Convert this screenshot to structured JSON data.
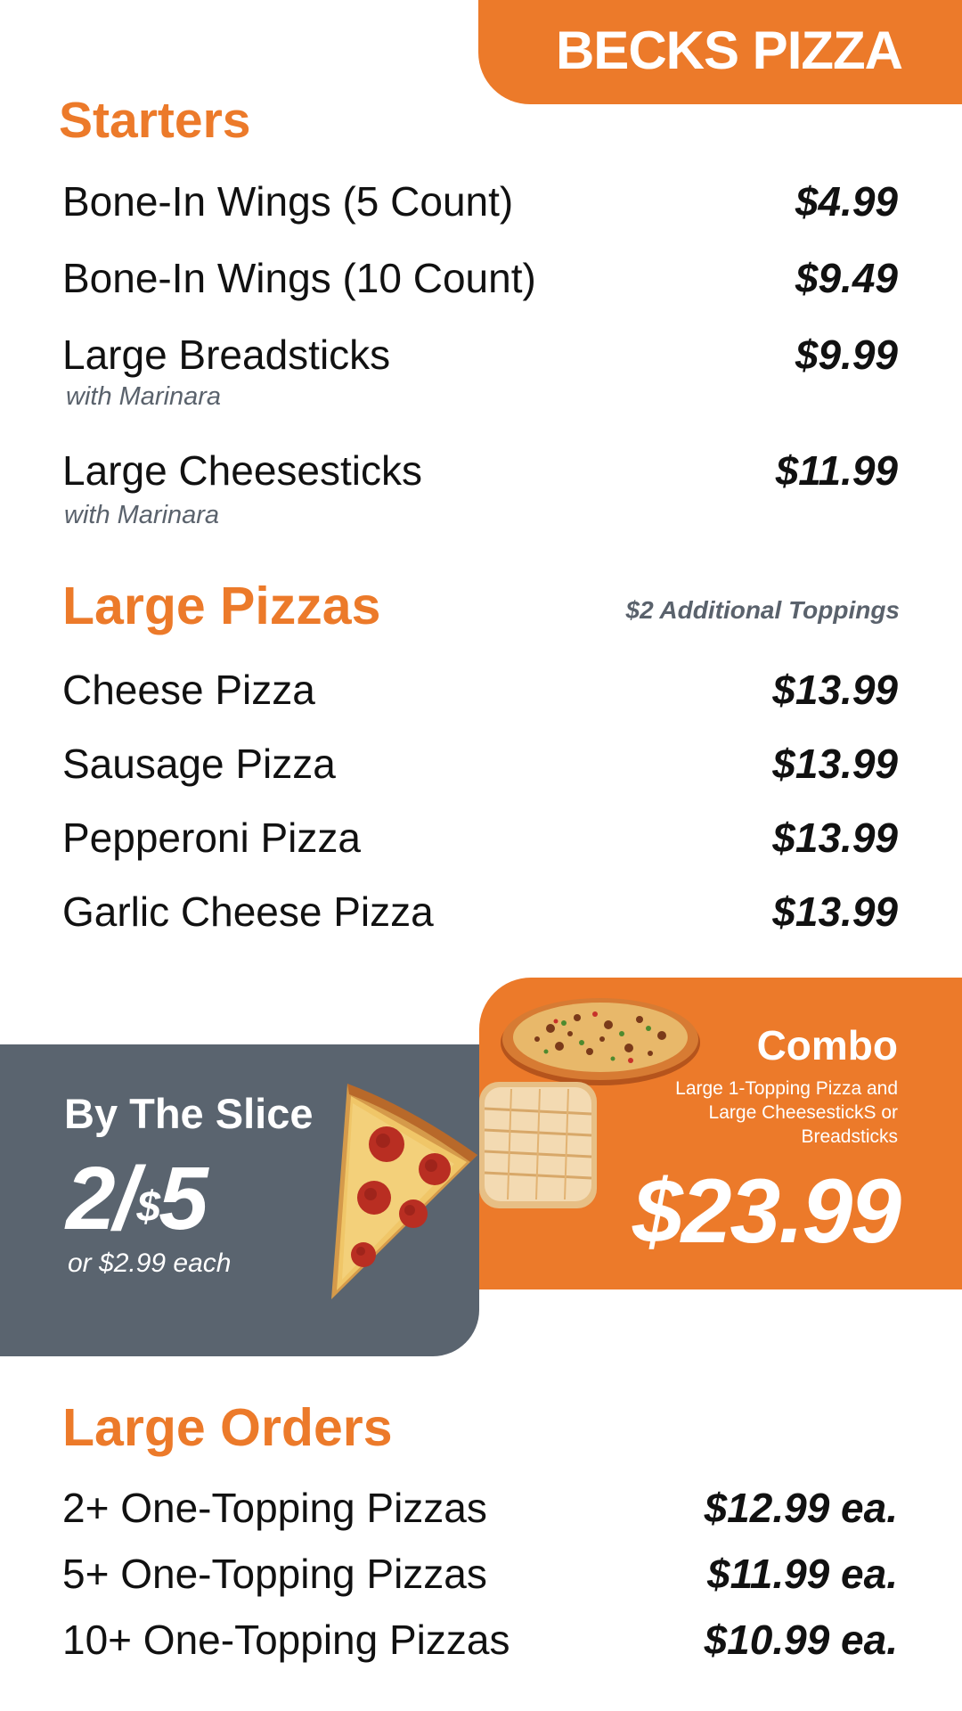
{
  "brand": {
    "name": "BECKS PIZZA"
  },
  "colors": {
    "accent": "#EC7A2A",
    "panel_gray": "#5A646F",
    "subtext": "#5A626C"
  },
  "starters": {
    "title": "Starters",
    "items": [
      {
        "name": "Bone-In Wings (5 Count)",
        "price": "$4.99",
        "sub": ""
      },
      {
        "name": "Bone-In Wings (10 Count)",
        "price": "$9.49",
        "sub": ""
      },
      {
        "name": "Large Breadsticks",
        "price": "$9.99",
        "sub": "with Marinara"
      },
      {
        "name": "Large Cheesesticks",
        "price": "$11.99",
        "sub": "with Marinara"
      }
    ]
  },
  "large_pizzas": {
    "title": "Large Pizzas",
    "note": "$2 Additional Toppings",
    "items": [
      {
        "name": "Cheese Pizza",
        "price": "$13.99"
      },
      {
        "name": "Sausage Pizza",
        "price": "$13.99"
      },
      {
        "name": "Pepperoni Pizza",
        "price": "$13.99"
      },
      {
        "name": "Garlic Cheese Pizza",
        "price": "$13.99"
      }
    ]
  },
  "by_the_slice": {
    "title": "By The Slice",
    "price_main": "2/",
    "price_sup": "$",
    "price_end": "5",
    "sub": "or $2.99 each"
  },
  "combo": {
    "title": "Combo",
    "description": "Large 1-Topping Pizza and Large CheesestickS or Breadsticks",
    "price": "$23.99"
  },
  "large_orders": {
    "title": "Large Orders",
    "items": [
      {
        "name": "2+ One-Topping Pizzas",
        "price": "$12.99 ea."
      },
      {
        "name": "5+ One-Topping Pizzas",
        "price": "$11.99 ea."
      },
      {
        "name": "10+ One-Topping Pizzas",
        "price": "$10.99 ea."
      }
    ]
  },
  "images": {
    "combo_pizza": "whole-pizza-image",
    "combo_breadsticks": "breadsticks-image",
    "slice": "pepperoni-slice-image"
  }
}
